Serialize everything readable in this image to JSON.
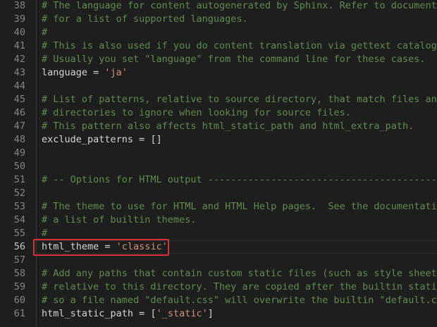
{
  "editor": {
    "language": "python",
    "current_line": 56,
    "lines": [
      {
        "number": "38",
        "tokens": [
          {
            "type": "comment",
            "text": "# The language for content autogenerated by Sphinx. Refer to documentatio"
          }
        ]
      },
      {
        "number": "39",
        "tokens": [
          {
            "type": "comment",
            "text": "# for a list of supported languages."
          }
        ]
      },
      {
        "number": "40",
        "tokens": [
          {
            "type": "comment",
            "text": "#"
          }
        ]
      },
      {
        "number": "41",
        "tokens": [
          {
            "type": "comment",
            "text": "# This is also used if you do content translation via gettext catalogs."
          }
        ]
      },
      {
        "number": "42",
        "tokens": [
          {
            "type": "comment",
            "text": "# Usually you set \"language\" from the command line for these cases."
          }
        ]
      },
      {
        "number": "43",
        "tokens": [
          {
            "type": "ident",
            "text": "language"
          },
          {
            "type": "op",
            "text": " = "
          },
          {
            "type": "str",
            "text": "'ja'"
          }
        ]
      },
      {
        "number": "44",
        "tokens": []
      },
      {
        "number": "45",
        "tokens": [
          {
            "type": "comment",
            "text": "# List of patterns, relative to source directory, that match files and"
          }
        ]
      },
      {
        "number": "46",
        "tokens": [
          {
            "type": "comment",
            "text": "# directories to ignore when looking for source files."
          }
        ]
      },
      {
        "number": "47",
        "tokens": [
          {
            "type": "comment",
            "text": "# This pattern also affects html_static_path and html_extra_path."
          }
        ]
      },
      {
        "number": "48",
        "tokens": [
          {
            "type": "ident",
            "text": "exclude_patterns"
          },
          {
            "type": "op",
            "text": " = "
          },
          {
            "type": "punc",
            "text": "[]"
          }
        ]
      },
      {
        "number": "49",
        "tokens": []
      },
      {
        "number": "50",
        "tokens": []
      },
      {
        "number": "51",
        "tokens": [
          {
            "type": "comment",
            "text": "# -- Options for HTML output -------------------------------------------------"
          }
        ]
      },
      {
        "number": "52",
        "tokens": []
      },
      {
        "number": "53",
        "tokens": [
          {
            "type": "comment",
            "text": "# The theme to use for HTML and HTML Help pages.  See the documentation for"
          }
        ]
      },
      {
        "number": "54",
        "tokens": [
          {
            "type": "comment",
            "text": "# a list of builtin themes."
          }
        ]
      },
      {
        "number": "55",
        "tokens": [
          {
            "type": "comment",
            "text": "#"
          }
        ]
      },
      {
        "number": "56",
        "tokens": [
          {
            "type": "ident",
            "text": "html_theme"
          },
          {
            "type": "op",
            "text": " = "
          },
          {
            "type": "str",
            "text": "'classic'"
          }
        ]
      },
      {
        "number": "57",
        "tokens": []
      },
      {
        "number": "58",
        "tokens": [
          {
            "type": "comment",
            "text": "# Add any paths that contain custom static files (such as style sheets) h"
          }
        ]
      },
      {
        "number": "59",
        "tokens": [
          {
            "type": "comment",
            "text": "# relative to this directory. They are copied after the builtin static fi"
          }
        ]
      },
      {
        "number": "60",
        "tokens": [
          {
            "type": "comment",
            "text": "# so a file named \"default.css\" will overwrite the builtin \"default.css\"."
          }
        ]
      },
      {
        "number": "61",
        "tokens": [
          {
            "type": "ident",
            "text": "html_static_path"
          },
          {
            "type": "op",
            "text": " = "
          },
          {
            "type": "punc",
            "text": "["
          },
          {
            "type": "str",
            "text": "'_static'"
          },
          {
            "type": "punc",
            "text": "]"
          }
        ]
      }
    ]
  },
  "highlight": {
    "line": "56",
    "color": "#d7323c"
  },
  "colors": {
    "background": "#1e1e1e",
    "line_number": "#858585",
    "comment": "#608b4e",
    "identifier": "#d4d4d4",
    "string": "#ce9178"
  }
}
